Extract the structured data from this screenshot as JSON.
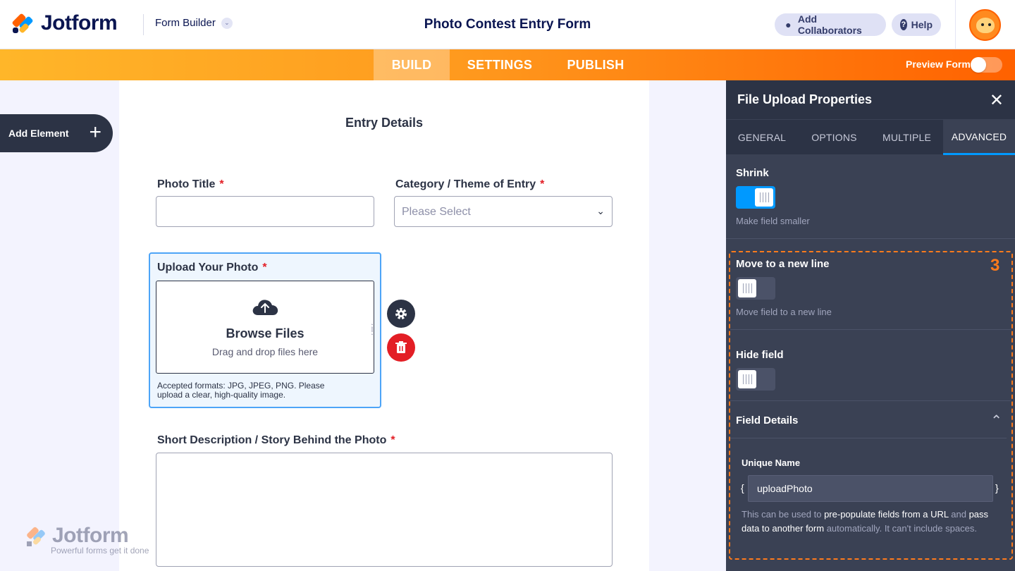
{
  "header": {
    "logo_text": "Jotform",
    "builder_label": "Form Builder",
    "form_title": "Photo Contest Entry Form",
    "add_collaborators": "Add Collaborators",
    "help": "Help"
  },
  "nav": {
    "tabs": [
      {
        "label": "BUILD",
        "active": true
      },
      {
        "label": "SETTINGS",
        "active": false
      },
      {
        "label": "PUBLISH",
        "active": false
      }
    ],
    "preview_label": "Preview Form",
    "preview_on": false
  },
  "sidebar": {
    "add_element": "Add Element"
  },
  "form": {
    "section_title": "Entry Details",
    "photo_title_label": "Photo Title",
    "category_label": "Category / Theme of Entry",
    "category_placeholder": "Please Select",
    "upload_label": "Upload Your Photo",
    "browse_files": "Browse Files",
    "drag_drop": "Drag and drop files here",
    "accepted_formats": "Accepted formats: JPG, JPEG, PNG. Please upload a clear, high-quality image.",
    "description_label": "Short Description / Story Behind the Photo",
    "required_mark": "*"
  },
  "watermark": {
    "logo_text": "Jotform",
    "tagline": "Powerful forms get it done"
  },
  "panel": {
    "title": "File Upload Properties",
    "tabs": [
      {
        "label": "GENERAL",
        "active": false
      },
      {
        "label": "OPTIONS",
        "active": false
      },
      {
        "label": "MULTIPLE",
        "active": false
      },
      {
        "label": "ADVANCED",
        "active": true
      }
    ],
    "shrink": {
      "label": "Shrink",
      "desc": "Make field smaller",
      "on": true
    },
    "new_line": {
      "label": "Move to a new line",
      "desc": "Move field to a new line",
      "on": false
    },
    "hide": {
      "label": "Hide field",
      "on": false
    },
    "field_details": "Field Details",
    "unique_name_label": "Unique Name",
    "unique_name_value": "uploadPhoto",
    "help_part1": "This can be used to ",
    "help_bold1": "pre-populate fields from a URL",
    "help_part2": " and ",
    "help_bold2": "pass data to another form",
    "help_part3": " automatically. It can't include spaces.",
    "step_marker": "3"
  },
  "colors": {
    "accent_orange": "#ff6100",
    "toggle_on": "#0099ff",
    "panel_bg": "#3a4154",
    "highlight": "#ff7b1c"
  }
}
